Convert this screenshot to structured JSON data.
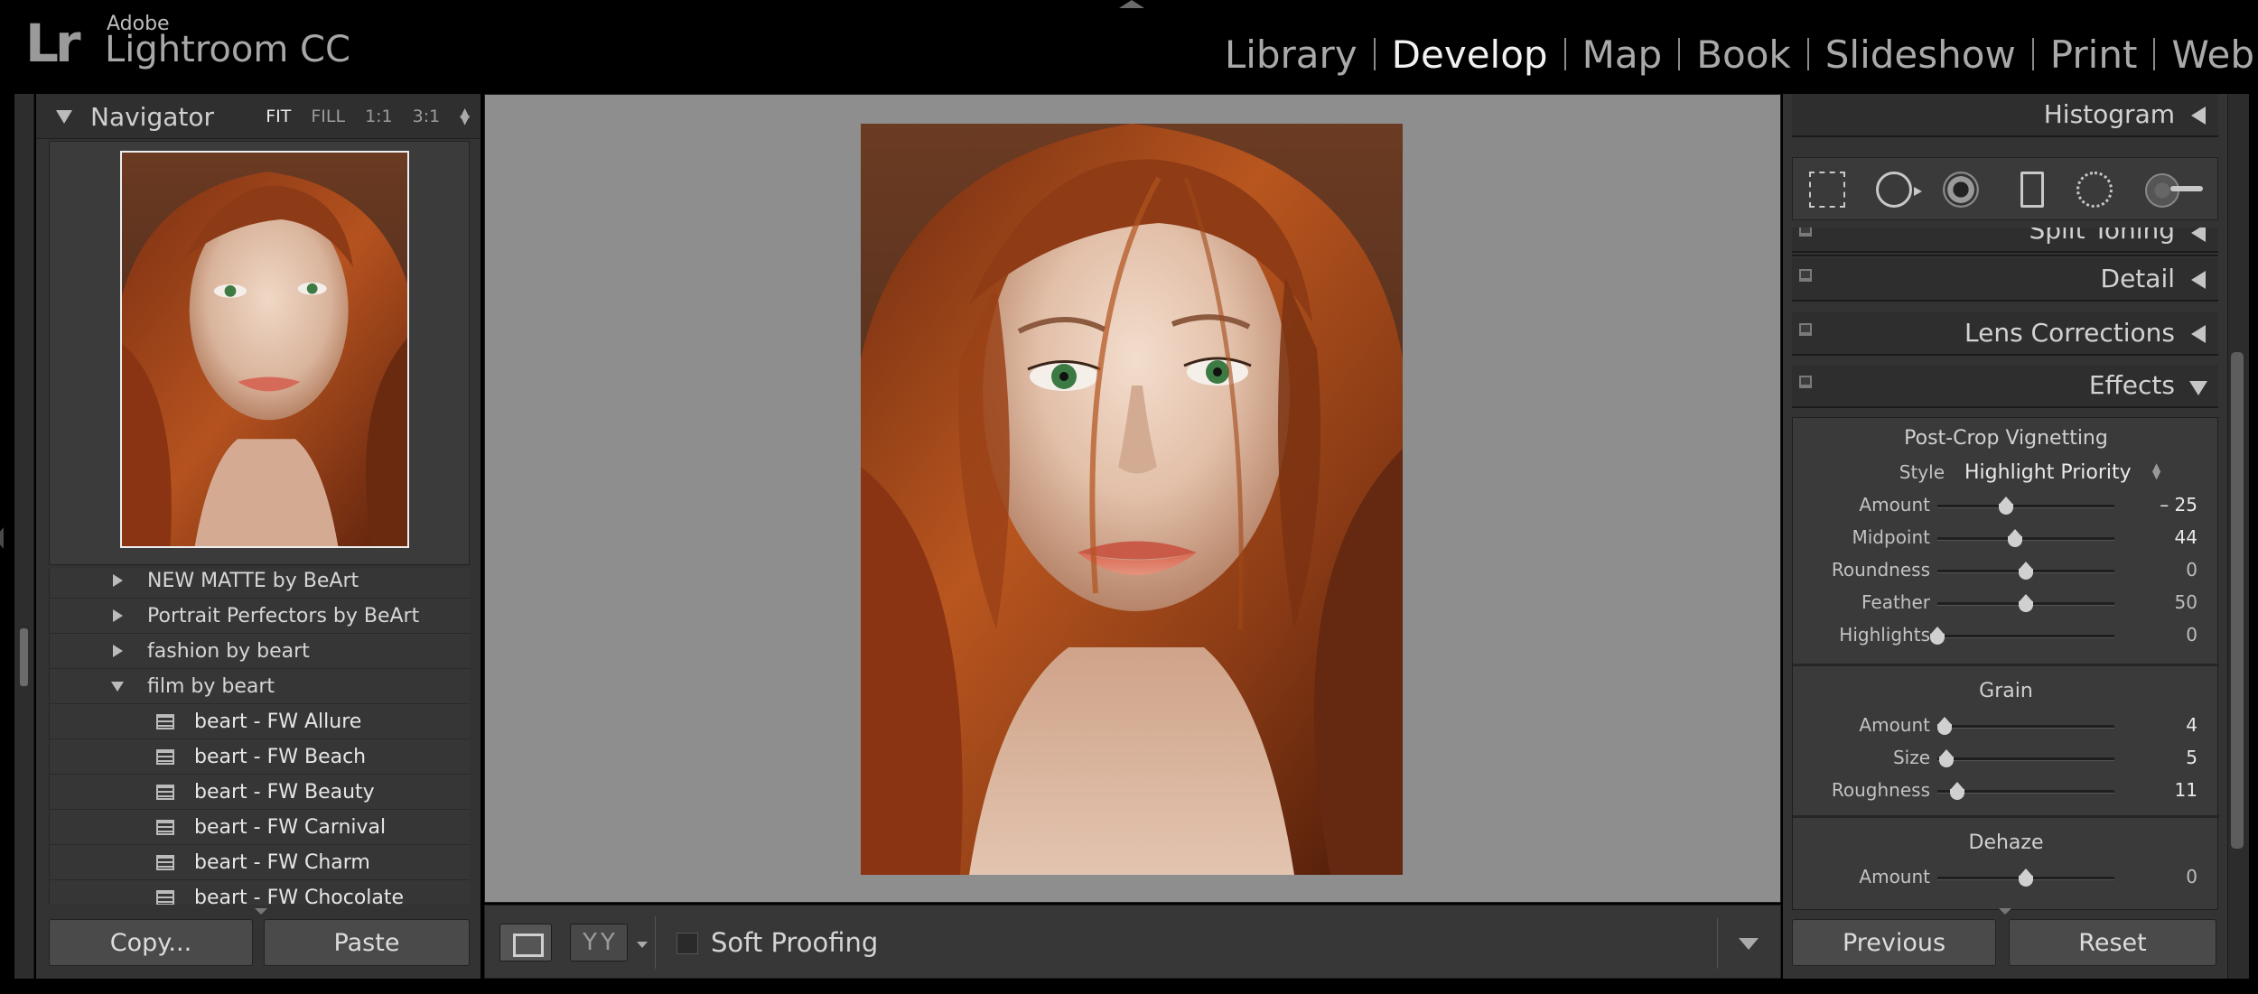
{
  "app": {
    "vendor": "Adobe",
    "name": "Lightroom CC",
    "logo": "Lr"
  },
  "modules": [
    {
      "label": "Library",
      "active": false
    },
    {
      "label": "Develop",
      "active": true
    },
    {
      "label": "Map",
      "active": false
    },
    {
      "label": "Book",
      "active": false
    },
    {
      "label": "Slideshow",
      "active": false
    },
    {
      "label": "Print",
      "active": false
    },
    {
      "label": "Web",
      "active": false
    }
  ],
  "navigator": {
    "title": "Navigator",
    "zoom": [
      "FIT",
      "FILL",
      "1:1",
      "3:1"
    ],
    "zoom_active": "FIT"
  },
  "presets": {
    "folders": [
      {
        "label": "NEW MATTE by BeArt",
        "open": false
      },
      {
        "label": "Portrait Perfectors by BeArt",
        "open": false
      },
      {
        "label": "fashion by beart",
        "open": false
      },
      {
        "label": "film by beart",
        "open": true
      }
    ],
    "items": [
      "beart - FW Allure",
      "beart - FW Beach",
      "beart - FW Beauty",
      "beart - FW Carnival",
      "beart - FW Charm",
      "beart - FW Chocolate"
    ]
  },
  "left_buttons": {
    "copy": "Copy...",
    "paste": "Paste"
  },
  "toolbar": {
    "soft_proofing": "Soft Proofing",
    "yy": [
      "Y",
      "Y"
    ]
  },
  "right_panel": {
    "sections": {
      "histogram": "Histogram",
      "split_toning": "Split Toning",
      "detail": "Detail",
      "lens": "Lens Corrections",
      "effects": "Effects"
    },
    "vignetting": {
      "title": "Post-Crop Vignetting",
      "style_label": "Style",
      "style_value": "Highlight Priority",
      "sliders": [
        {
          "label": "Amount",
          "value": "– 25",
          "pos": 0.39,
          "dim": false
        },
        {
          "label": "Midpoint",
          "value": "44",
          "pos": 0.44,
          "dim": false
        },
        {
          "label": "Roundness",
          "value": "0",
          "pos": 0.5,
          "dim": true
        },
        {
          "label": "Feather",
          "value": "50",
          "pos": 0.5,
          "dim": true
        },
        {
          "label": "Highlights",
          "value": "0",
          "pos": 0.0,
          "dim": true
        }
      ]
    },
    "grain": {
      "title": "Grain",
      "sliders": [
        {
          "label": "Amount",
          "value": "4",
          "pos": 0.04,
          "dim": false
        },
        {
          "label": "Size",
          "value": "5",
          "pos": 0.05,
          "dim": false
        },
        {
          "label": "Roughness",
          "value": "11",
          "pos": 0.11,
          "dim": false
        }
      ]
    },
    "dehaze": {
      "title": "Dehaze",
      "sliders": [
        {
          "label": "Amount",
          "value": "0",
          "pos": 0.5,
          "dim": true
        }
      ]
    }
  },
  "right_buttons": {
    "previous": "Previous",
    "reset": "Reset"
  }
}
